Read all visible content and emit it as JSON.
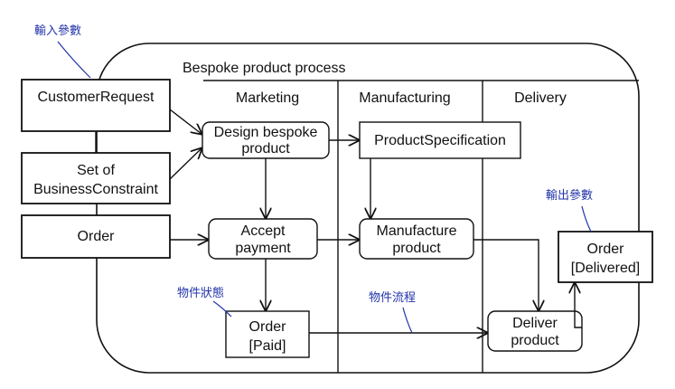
{
  "activity_title": "Bespoke product process",
  "partitions": [
    "Marketing",
    "Manufacturing",
    "Delivery"
  ],
  "input_params": {
    "customer_request": "CustomerRequest",
    "business_constraint": [
      "Set of",
      "BusinessConstraint"
    ],
    "order": "Order"
  },
  "output_param": [
    "Order",
    "[Delivered]"
  ],
  "actions": {
    "design": [
      "Design bespoke",
      "product"
    ],
    "accept": [
      "Accept",
      "payment"
    ],
    "manufacture": [
      "Manufacture",
      "product"
    ],
    "deliver": [
      "Deliver",
      "product"
    ]
  },
  "objects": {
    "spec": "ProductSpecification",
    "order_paid": [
      "Order",
      "[Paid]"
    ]
  },
  "annotations": {
    "input_parameter": "輸入參數",
    "output_parameter": "輸出參數",
    "object_state": "物件狀態",
    "object_flow": "物件流程"
  },
  "colors": {
    "line": "#111111",
    "annotation": "#2233aa"
  }
}
